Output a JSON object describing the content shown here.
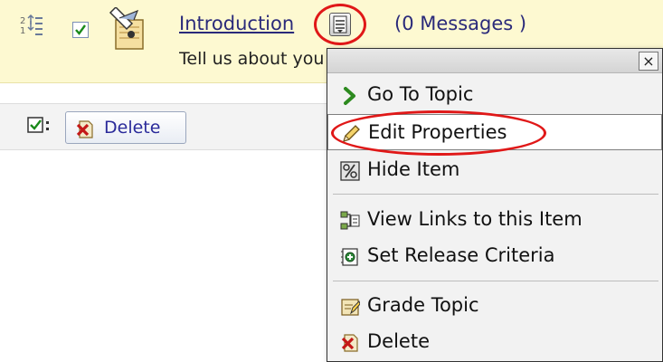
{
  "topic": {
    "title": "Introduction",
    "message_count": "(0 Messages )",
    "description": "Tell us about yourself"
  },
  "bulk_bar": {
    "delete_label": "Delete"
  },
  "context_menu": {
    "close_label": "×",
    "items": [
      {
        "label": "Go To Topic",
        "icon": "arrow-right-icon"
      },
      {
        "label": "Edit Properties",
        "icon": "pencil-icon"
      },
      {
        "label": "Hide Item",
        "icon": "hide-icon"
      },
      {
        "label": "View Links to this Item",
        "icon": "links-icon"
      },
      {
        "label": "Set Release Criteria",
        "icon": "release-criteria-icon"
      },
      {
        "label": "Grade Topic",
        "icon": "grade-icon"
      },
      {
        "label": "Delete",
        "icon": "delete-icon"
      }
    ]
  },
  "colors": {
    "row_background": "#fdf9d1",
    "link_text": "#2a2a7a",
    "annotation_ring": "#e01818"
  }
}
